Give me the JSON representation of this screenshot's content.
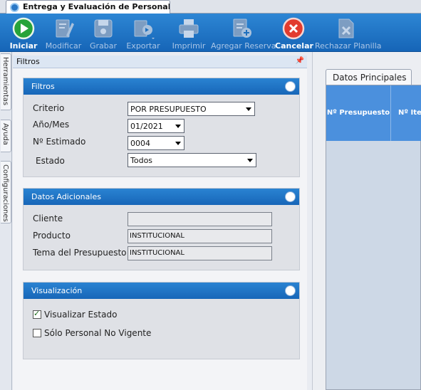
{
  "document_tab": {
    "title": "Entrega y Evaluación de Personal ..."
  },
  "toolbar": {
    "buttons": [
      {
        "label": "Iniciar",
        "icon": "play-icon"
      },
      {
        "label": "Modificar",
        "icon": "edit-icon"
      },
      {
        "label": "Grabar",
        "icon": "save-icon"
      },
      {
        "label": "Exportar",
        "icon": "export-icon"
      },
      {
        "label": "Imprimir",
        "icon": "print-icon"
      },
      {
        "label": "Agregar Reserva",
        "icon": "add-reserve-icon"
      },
      {
        "label": "Cancelar",
        "icon": "cancel-icon"
      },
      {
        "label": "Rechazar Planilla",
        "icon": "reject-sheet-icon"
      }
    ]
  },
  "side_tabs": [
    "Herramientas",
    "Ayuda",
    "Configuraciones"
  ],
  "filter_panel": {
    "title": "Filtros",
    "filtros": {
      "title": "Filtros",
      "criterio_label": "Criterio",
      "criterio_value": "POR PRESUPUESTO",
      "anio_mes_label": "Año/Mes",
      "anio_mes_value": "01/2021",
      "estimado_label": "Nº Estimado",
      "estimado_value": "0004",
      "estado_label": "Estado",
      "estado_value": "Todos"
    },
    "datos_adicionales": {
      "title": "Datos Adicionales",
      "cliente_label": "Cliente",
      "cliente_value": "",
      "producto_label": "Producto",
      "producto_value": "INSTITUCIONAL",
      "tema_label": "Tema del Presupuesto",
      "tema_value": "INSTITUCIONAL"
    },
    "visualizacion": {
      "title": "Visualización",
      "visualizar_estado_label": "Visualizar Estado",
      "visualizar_estado_checked": true,
      "solo_personal_label": "Sólo Personal No Vigente",
      "solo_personal_checked": false
    }
  },
  "main": {
    "tab_label": "Datos Principales",
    "columns": [
      "Nº Presupuesto",
      "Nº Item"
    ]
  },
  "colors": {
    "toolbar_blue": "#1f75c8",
    "group_header_blue": "#1f75c8",
    "grid_header_blue": "#4b90dd"
  }
}
